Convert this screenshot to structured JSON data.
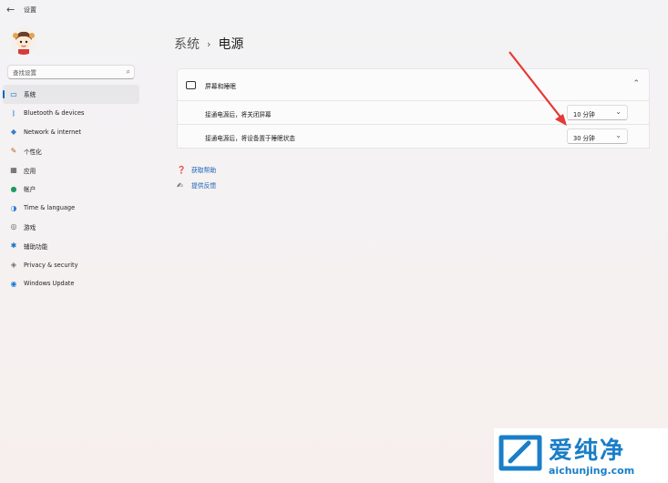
{
  "app": {
    "title": "设置",
    "back_glyph": "←"
  },
  "search": {
    "placeholder": "查找设置"
  },
  "nav": {
    "items": [
      {
        "label": "系统",
        "icon": "monitor-icon",
        "glyph": "▭",
        "color": "#0067c0",
        "active": true
      },
      {
        "label": "Bluetooth & devices",
        "icon": "bluetooth-icon",
        "glyph": "ᛒ",
        "color": "#0a72d1"
      },
      {
        "label": "Network & internet",
        "icon": "network-icon",
        "glyph": "◆",
        "color": "#3b7cc7"
      },
      {
        "label": "个性化",
        "icon": "pen-icon",
        "glyph": "✎",
        "color": "#b5651d"
      },
      {
        "label": "应用",
        "icon": "apps-icon",
        "glyph": "▦",
        "color": "#4a4a4a"
      },
      {
        "label": "帐户",
        "icon": "person-icon",
        "glyph": "●",
        "color": "#1e9a62"
      },
      {
        "label": "Time & language",
        "icon": "globe-clock-icon",
        "glyph": "◑",
        "color": "#2f7ed8"
      },
      {
        "label": "游戏",
        "icon": "gamepad-icon",
        "glyph": "◎",
        "color": "#5a5a5a"
      },
      {
        "label": "辅助功能",
        "icon": "accessibility-icon",
        "glyph": "✱",
        "color": "#0e6fc4"
      },
      {
        "label": "Privacy & security",
        "icon": "shield-icon",
        "glyph": "◈",
        "color": "#6d6d6d"
      },
      {
        "label": "Windows Update",
        "icon": "update-icon",
        "glyph": "◉",
        "color": "#1b79d3"
      }
    ]
  },
  "breadcrumb": {
    "parent": "系统",
    "separator": "›",
    "current": "电源"
  },
  "panel": {
    "title": "屏幕和睡眠",
    "chevron": "⌃",
    "rows": [
      {
        "label": "接通电源后，将关闭屏幕",
        "value": "10 分钟"
      },
      {
        "label": "接通电源后，将设备置于睡眠状态",
        "value": "30 分钟"
      }
    ]
  },
  "dropdown_chevron": "⌄",
  "links": [
    {
      "label": "获取帮助",
      "icon": "help-icon",
      "glyph": "❓"
    },
    {
      "label": "提供反馈",
      "icon": "feedback-icon",
      "glyph": "✍"
    }
  ],
  "watermark": {
    "title": "爱纯净",
    "url": "aichunjing.com"
  },
  "colors": {
    "accent": "#0067c0",
    "annotation_arrow": "#e53935",
    "watermark": "#1a7ec8"
  }
}
